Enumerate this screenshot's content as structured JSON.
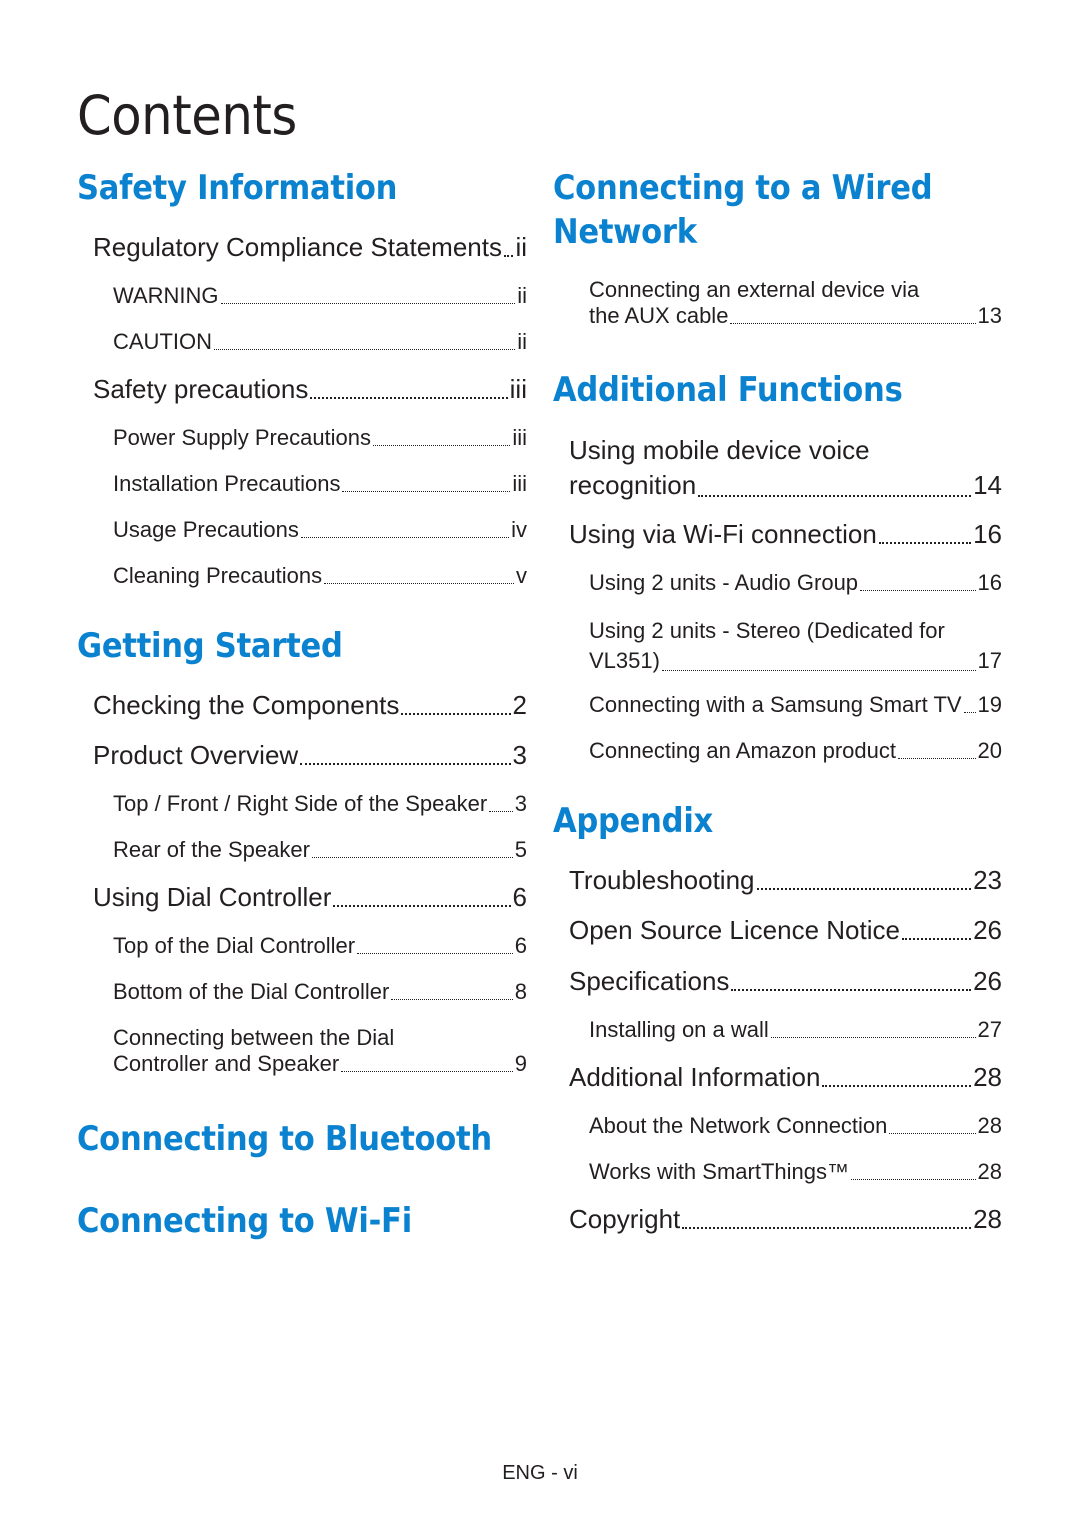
{
  "title": "Contents",
  "accent_color": "#0a82cf",
  "left_column": {
    "safety": {
      "heading": "Safety Information",
      "entries": [
        {
          "label": "Regulatory Compliance Statements",
          "page": "ii",
          "level": 1
        },
        {
          "label": "WARNING",
          "page": "ii",
          "level": 2
        },
        {
          "label": "CAUTION",
          "page": "ii",
          "level": 2
        },
        {
          "label": "Safety precautions",
          "page": "iii",
          "level": 1
        },
        {
          "label": "Power Supply Precautions",
          "page": "iii",
          "level": 2
        },
        {
          "label": "Installation Precautions",
          "page": "iii",
          "level": 2
        },
        {
          "label": "Usage Precautions",
          "page": "iv",
          "level": 2
        },
        {
          "label": "Cleaning Precautions",
          "page": "v",
          "level": 2
        }
      ]
    },
    "getting_started": {
      "heading": "Getting Started",
      "entries": [
        {
          "label": "Checking the Components",
          "page": "2",
          "level": 1
        },
        {
          "label": "Product Overview",
          "page": "3",
          "level": 1
        },
        {
          "label": "Top / Front / Right Side of the Speaker",
          "page": "3",
          "level": 2
        },
        {
          "label": "Rear of the Speaker",
          "page": "5",
          "level": 2
        },
        {
          "label": "Using Dial Controller",
          "page": "6",
          "level": 1
        },
        {
          "label": "Top of the Dial Controller",
          "page": "6",
          "level": 2
        },
        {
          "label": "Bottom of the Dial Controller",
          "page": "8",
          "level": 2
        },
        {
          "label_line1": "Connecting between the Dial",
          "label_line2": "Controller and Speaker",
          "page": "9",
          "level": 2
        }
      ]
    },
    "bluetooth": {
      "heading": "Connecting to Bluetooth"
    },
    "wifi": {
      "heading": "Connecting to Wi-Fi"
    }
  },
  "right_column": {
    "wired": {
      "heading_line1": "Connecting to a Wired",
      "heading_line2": "Network",
      "entries": [
        {
          "label_line1": "Connecting an external device via",
          "label_line2": "the AUX cable",
          "page": "13",
          "level": 2
        }
      ]
    },
    "additional_functions": {
      "heading": "Additional Functions",
      "entries": [
        {
          "label_line1": "Using mobile device voice",
          "label_line2": "recognition",
          "page": "14",
          "level": 1
        },
        {
          "label": "Using via Wi-Fi connection",
          "page": "16",
          "level": 1
        },
        {
          "label": "Using 2 units - Audio Group",
          "page": "16",
          "level": 2
        },
        {
          "label_line1": "Using 2 units - Stereo (Dedicated for",
          "label_line2": "VL351)",
          "page": "17",
          "level": 2
        },
        {
          "label": "Connecting with a Samsung Smart TV",
          "page": "19",
          "level": 2
        },
        {
          "label": "Connecting an Amazon product",
          "page": "20",
          "level": 2
        }
      ]
    },
    "appendix": {
      "heading": "Appendix",
      "entries": [
        {
          "label": "Troubleshooting",
          "page": "23",
          "level": 1
        },
        {
          "label": "Open Source Licence Notice",
          "page": "26",
          "level": 1
        },
        {
          "label": "Specifications",
          "page": "26",
          "level": 1
        },
        {
          "label": "Installing on a wall",
          "page": "27",
          "level": 2
        },
        {
          "label": "Additional Information",
          "page": "28",
          "level": 1
        },
        {
          "label": "About the Network Connection",
          "page": "28",
          "level": 2
        },
        {
          "label": "Works with SmartThings™",
          "page": "28",
          "level": 2
        },
        {
          "label": "Copyright",
          "page": "28",
          "level": 1
        }
      ]
    }
  },
  "footer": "ENG - vi"
}
